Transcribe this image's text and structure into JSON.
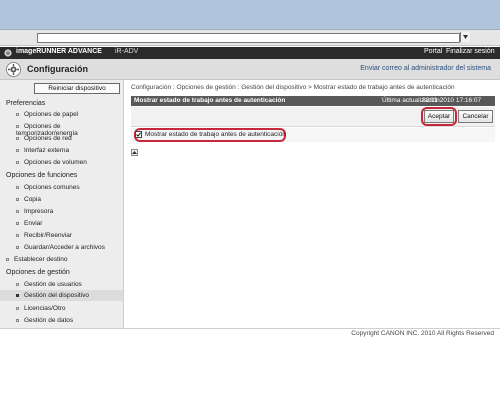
{
  "address_bar": {
    "value": ""
  },
  "brand": {
    "logo_icon": "canon-logo-icon",
    "name": "imageRUNNER ADVANCE",
    "model": "iR-ADV",
    "portal_link": "Portal",
    "logout_link": "Finalizar sesión"
  },
  "header": {
    "title": "Configuración",
    "icon": "settings-gear-icon",
    "email_admin_link": "Enviar correo al administrador del sistema"
  },
  "sidebar": {
    "restart_button": "Reiniciar dispositivo",
    "sections": [
      {
        "heading": "Preferencias",
        "items": [
          {
            "label": "Opciones de papel"
          },
          {
            "label": "Opciones de temporizador/energía"
          },
          {
            "label": "Opciones de red"
          },
          {
            "label": "Interfaz externa"
          },
          {
            "label": "Opciones de volumen"
          }
        ]
      },
      {
        "heading": "Opciones de funciones",
        "items": [
          {
            "label": "Opciones comunes"
          },
          {
            "label": "Copia"
          },
          {
            "label": "Impresora"
          },
          {
            "label": "Enviar"
          },
          {
            "label": "Recibir/Reenviar"
          },
          {
            "label": "Guardar/Acceder a archivos"
          }
        ]
      },
      {
        "top_item": "Establecer destino"
      },
      {
        "heading": "Opciones de gestión",
        "items": [
          {
            "label": "Gestión de usuarios"
          },
          {
            "label": "Gestión del dispositivo",
            "active": true
          },
          {
            "label": "Licencias/Otro"
          },
          {
            "label": "Gestión de datos"
          }
        ]
      }
    ]
  },
  "main": {
    "breadcrumb": "Configuración : Opciones de gestión : Gestión del dispositivo > Mostrar estado de trabajo antes de autenticación",
    "panel_title": "Mostrar estado de trabajo antes de autenticación",
    "last_update_label": "Última actualización :",
    "last_update_value": "22/11 2010 17:16:07",
    "accept_button": "Aceptar",
    "cancel_button": "Cancelar",
    "checkbox_label": "Mostrar estado de trabajo antes de autenticación",
    "checkbox_checked": true
  },
  "footer": {
    "copyright": "Copyright CANON INC. 2010 All Rights Reserved"
  },
  "colors": {
    "highlight_ring": "#c5283b",
    "brand_bar": "#2b2b2b",
    "panel_bar": "#595959",
    "window_chrome": "#b0c4dc"
  }
}
